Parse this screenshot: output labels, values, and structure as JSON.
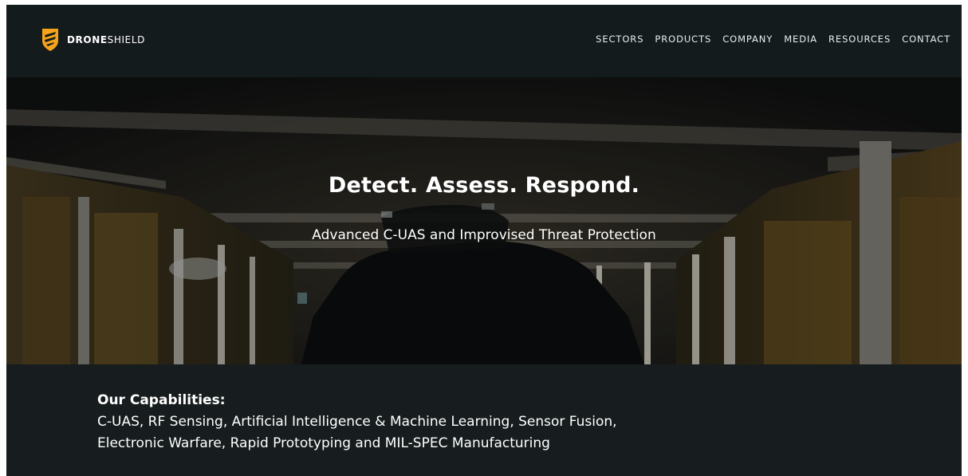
{
  "brand": {
    "name_bold": "DRONE",
    "name_rest": "SHIELD",
    "logo_icon": "shield-logo-icon",
    "accent_color": "#f5a31a"
  },
  "nav": {
    "items": [
      {
        "label": "SECTORS"
      },
      {
        "label": "PRODUCTS"
      },
      {
        "label": "COMPANY"
      },
      {
        "label": "MEDIA"
      },
      {
        "label": "RESOURCES"
      },
      {
        "label": "CONTACT"
      }
    ]
  },
  "hero": {
    "title": "Detect. Assess. Respond.",
    "subtitle": "Advanced C-UAS and Improvised Threat Protection"
  },
  "capabilities": {
    "heading": "Our Capabilities:",
    "text": "C-UAS, RF Sensing, Artificial Intelligence & Machine Learning, Sensor Fusion, Electronic Warfare, Rapid Prototyping and MIL-SPEC Manufacturing"
  },
  "colors": {
    "header_bg": "#141b1c",
    "page_bg": "#171d1e",
    "text": "#ffffff"
  }
}
